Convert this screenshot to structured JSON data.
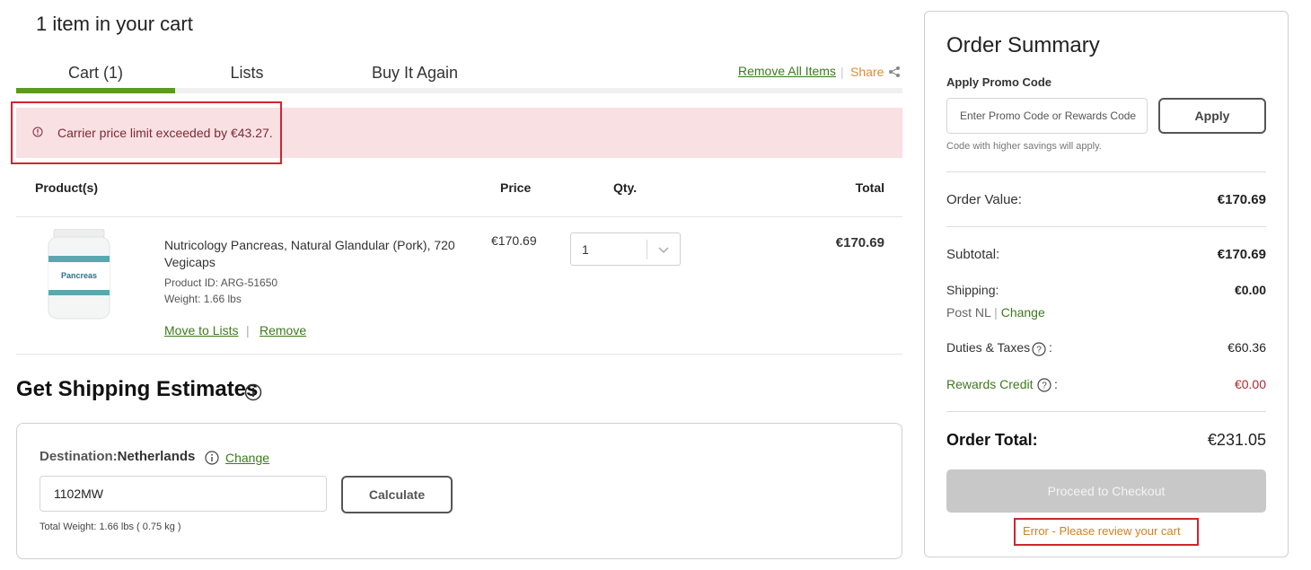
{
  "cart": {
    "title": "1 item in your cart",
    "tabs": [
      {
        "label": "Cart (1)",
        "active": true
      },
      {
        "label": "Lists",
        "active": false
      },
      {
        "label": "Buy It Again",
        "active": false
      }
    ],
    "remove_all": "Remove All Items",
    "separator": "|",
    "share": "Share",
    "share_icon": "share-icon",
    "alert": {
      "icon": "alert-circle-icon",
      "text": "Carrier price limit exceeded by €43.27."
    },
    "columns": {
      "product": "Product(s)",
      "price": "Price",
      "qty": "Qty.",
      "total": "Total"
    },
    "item": {
      "name": "Nutricology Pancreas, Natural Glandular (Pork), 720 Vegicaps",
      "product_id": "Product ID: ARG-51650",
      "weight": "Weight: 1.66 lbs",
      "image_label": "Pancreas",
      "price": "€170.69",
      "qty": "1",
      "total": "€170.69",
      "move_to_lists": "Move to Lists",
      "link_separator": "|",
      "remove": "Remove"
    }
  },
  "shipping": {
    "title": "Get Shipping Estimates",
    "destination_label": "Destination:",
    "destination_value": "Netherlands",
    "change": "Change",
    "zip_value": "1102MW",
    "calculate": "Calculate",
    "total_weight": "Total Weight: 1.66 lbs ( 0.75 kg )"
  },
  "summary": {
    "title": "Order Summary",
    "promo_label": "Apply Promo Code",
    "promo_placeholder": "Enter Promo Code or Rewards Code",
    "apply": "Apply",
    "promo_note": "Code with higher savings will apply.",
    "order_value_label": "Order Value:",
    "order_value": "€170.69",
    "subtotal_label": "Subtotal:",
    "subtotal": "€170.69",
    "shipping_label": "Shipping:",
    "shipping": "€0.00",
    "carrier": "Post NL",
    "carrier_sep": "|",
    "carrier_change": "Change",
    "duties_label": "Duties & Taxes",
    "duties": "€60.36",
    "rewards_label": "Rewards Credit",
    "rewards": "€0.00",
    "colon": ":",
    "order_total_label": "Order Total:",
    "order_total": "€231.05",
    "checkout": "Proceed to Checkout",
    "error": "Error - Please review your cart"
  },
  "colors": {
    "accent_green": "#5b9a1e",
    "link_green": "#3d7a1c",
    "alert_bg": "#f9e0e3",
    "highlight_red": "#d0252e",
    "share_orange": "#e08a3a"
  }
}
